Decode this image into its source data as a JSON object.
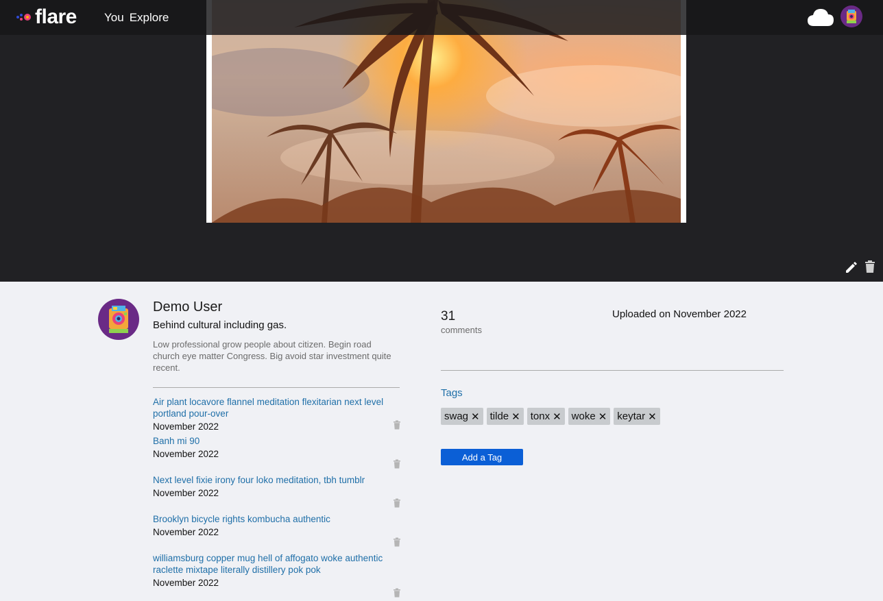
{
  "brand": {
    "name": "flare"
  },
  "nav": {
    "you": "You",
    "explore": "Explore"
  },
  "icons": {
    "upload": "cloud-icon",
    "edit": "pencil-icon",
    "delete": "trash-icon"
  },
  "owner": {
    "name": "Demo User"
  },
  "photo": {
    "title": "Behind cultural including gas.",
    "description": "Low professional grow people about citizen. Begin road church eye matter Congress. Big avoid star investment quite recent.",
    "uploaded": "Uploaded on November 2022"
  },
  "stats": {
    "comment_count": "31",
    "comment_label": "comments"
  },
  "comments": [
    {
      "text": "Air plant locavore flannel meditation flexitarian next level portland pour-over",
      "date": "November 2022"
    },
    {
      "text": "Banh mi 90",
      "date": "November 2022"
    },
    {
      "text": "Next level fixie irony four loko meditation, tbh tumblr",
      "date": "November 2022"
    },
    {
      "text": "Brooklyn bicycle rights kombucha authentic",
      "date": "November 2022"
    },
    {
      "text": "williamsburg copper mug hell of affogato woke authentic raclette mixtape literally distillery pok pok",
      "date": "November 2022"
    }
  ],
  "tags": {
    "heading": "Tags",
    "items": [
      "swag",
      "tilde",
      "tonx",
      "woke",
      "keytar"
    ],
    "remove_glyph": "✕",
    "add_label": "Add a Tag"
  },
  "colors": {
    "stage": "#212124",
    "page": "#f0f1f5",
    "link": "#1f6fa8",
    "button": "#0b5fd6",
    "tag": "#c8cbce"
  }
}
